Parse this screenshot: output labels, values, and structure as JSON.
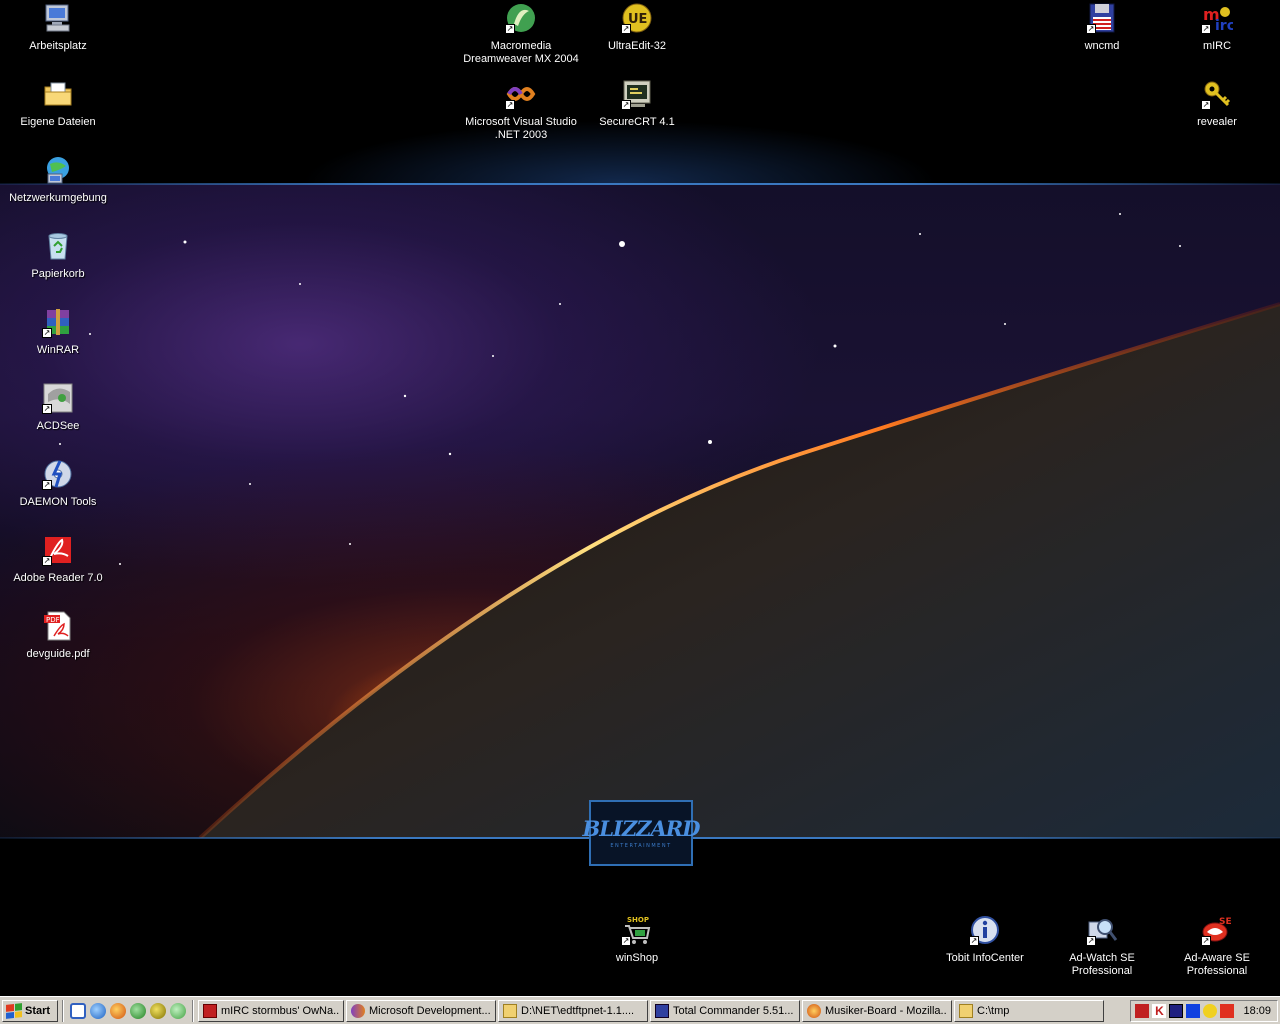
{
  "desktop": {
    "wallpaper_brand": "BLIZZARD",
    "wallpaper_brand_sub": "ENTERTAINMENT",
    "icons": [
      {
        "label": "Arbeitsplatz"
      },
      {
        "label": "Eigene Dateien"
      },
      {
        "label": "Netzwerkumgebung"
      },
      {
        "label": "Papierkorb"
      },
      {
        "label": "WinRAR"
      },
      {
        "label": "ACDSee"
      },
      {
        "label": "DAEMON Tools"
      },
      {
        "label": "Adobe Reader 7.0"
      },
      {
        "label": "devguide.pdf"
      },
      {
        "label": "Macromedia\nDreamweaver MX 2004"
      },
      {
        "label": "UltraEdit-32"
      },
      {
        "label": "Microsoft Visual Studio\n.NET 2003"
      },
      {
        "label": "SecureCRT 4.1"
      },
      {
        "label": "wncmd"
      },
      {
        "label": "mIRC"
      },
      {
        "label": "revealer"
      },
      {
        "label": "winShop"
      },
      {
        "label": "Tobit InfoCenter"
      },
      {
        "label": "Ad-Watch SE\nProfessional"
      },
      {
        "label": "Ad-Aware SE\nProfessional"
      }
    ]
  },
  "taskbar": {
    "start_label": "Start",
    "tasks": [
      {
        "label": "mIRC stormbus' OwNa..."
      },
      {
        "label": "Microsoft Development..."
      },
      {
        "label": "D:\\NET\\edtftpnet-1.1...."
      },
      {
        "label": "Total Commander 5.51..."
      },
      {
        "label": "Musiker-Board - Mozilla..."
      },
      {
        "label": "C:\\tmp"
      }
    ],
    "clock": "18:09"
  }
}
